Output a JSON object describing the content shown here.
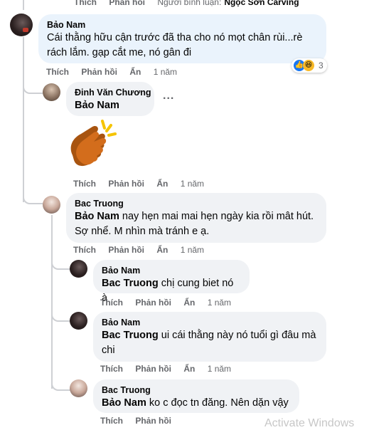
{
  "top_bar": {
    "like": "Thích",
    "reply": "Phản hồi",
    "commenter_label": "Người bình luận:",
    "commenter_name": "Ngọc Sơn Carving"
  },
  "comments": [
    {
      "author": "Bảo Nam",
      "text": "Cái thằng hữu cận trước đã tha cho nó mọt chân rùi...rè rách lắm. gạp cắt me, nó gân đi",
      "like": "Thích",
      "reply": "Phản hồi",
      "hide": "Ẩn",
      "time": "1 năm",
      "reactions_count": "3"
    },
    {
      "author": "Đinh Văn Chương",
      "mention": "Bảo Nam",
      "text": "",
      "like": "Thích",
      "reply": "Phản hồi",
      "hide": "Ẩn",
      "time": "1 năm",
      "more": "..."
    },
    {
      "author": "Bac Truong",
      "mention": "Bảo Nam",
      "text": " nay hẹn mai mai hẹn ngày kia rồi mât hút. Sợ nhể. M nhìn mà tránh e ạ.",
      "like": "Thích",
      "reply": "Phản hồi",
      "hide": "Ẩn",
      "time": "1 năm"
    },
    {
      "author": "Bảo Nam",
      "mention": "Bac Truong",
      "text": " chị cung biet nó à",
      "like": "Thích",
      "reply": "Phản hồi",
      "hide": "Ẩn",
      "time": "1 năm"
    },
    {
      "author": "Bảo Nam",
      "mention": "Bac Truong",
      "text": " ui cái thằng này nó tuổi gì đâu mà chi",
      "like": "Thích",
      "reply": "Phản hồi",
      "hide": "Ẩn",
      "time": "1 năm"
    },
    {
      "author": "Bac Truong",
      "mention": "Bảo Nam",
      "text": " ko c đọc tn đăng. Nên dặn vậy",
      "like": "Thích",
      "reply": "Phản hồi"
    }
  ],
  "watermark": "Activate Windows",
  "colors": {
    "bubble": "#f0f2f5",
    "bubble_highlight": "#eaf3fc",
    "meta": "#65676b",
    "like_blue": "#1877f2"
  }
}
